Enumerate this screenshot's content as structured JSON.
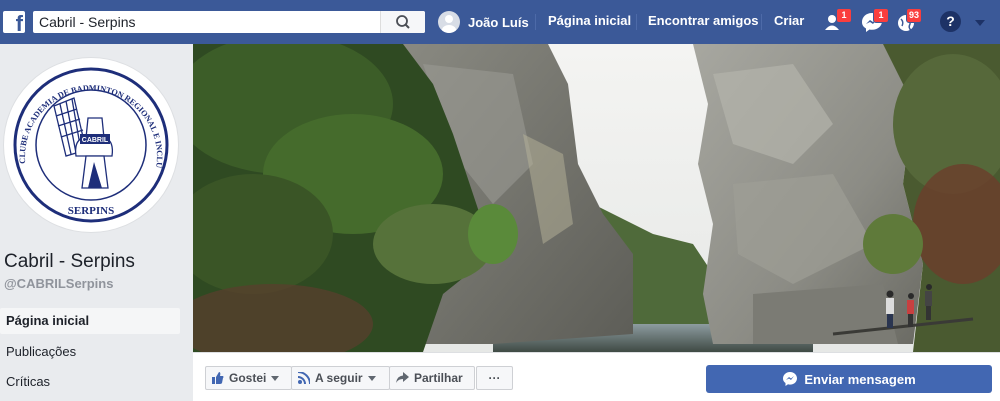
{
  "topbar": {
    "logo": "f",
    "search_value": "Cabril - Serpins",
    "user_name": "João Luís",
    "nav": {
      "home": "Página inicial",
      "find_friends": "Encontrar amigos",
      "create": "Criar"
    },
    "badges": {
      "friends": "1",
      "messages": "1",
      "notifications": "93"
    },
    "help": "?"
  },
  "page": {
    "name": "Cabril - Serpins",
    "handle": "@CABRILSerpins",
    "logo_text": {
      "arc": "CLUBE ACADEMIA DE BADMINTON REGIONAL E INCLUSIVA DA LOUSÃ",
      "badge": "CABRIL",
      "bottom": "SERPINS"
    }
  },
  "menu": [
    "Página inicial",
    "Publicações",
    "Críticas"
  ],
  "actions": {
    "like": "Gostei",
    "follow": "A seguir",
    "share": "Partilhar",
    "more": "···",
    "message": "Enviar mensagem"
  }
}
